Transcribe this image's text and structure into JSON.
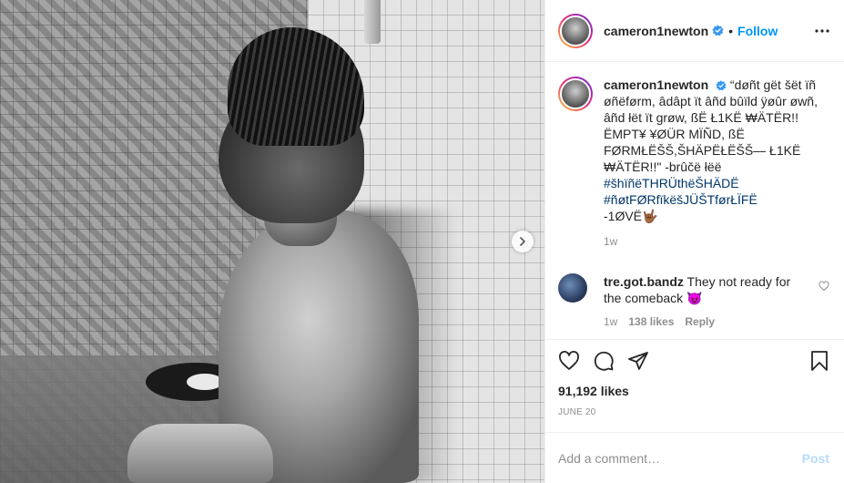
{
  "post": {
    "username": "cameron1newton",
    "follow_label": "Follow",
    "dot": "•",
    "caption": {
      "username": "cameron1newton",
      "text": " “døñt gët šët ïñ øñëførm, âdâpt ït âñd bûïld ÿøûr øwñ, âñd łët ït grøw, ßË Ł1KË ₩ÄTËR!! ËMPT¥ ¥ØÜR MÏÑD, ßË FØRMŁËŠŠ,ŠHÄPËŁËŠŠ— Ł1KË ₩ÄTËR!!\" -brûčë łëë",
      "hashtags": [
        "#šhïñëTHRÜthëŠHÄDË",
        "#ñøtFØRfïkëšJÜŠTførŁÏFË"
      ],
      "signoff": "-1ØVË🤟🏾",
      "age": "1w"
    },
    "comments": [
      {
        "username": "tre.got.bandz",
        "text": " They not ready for the comeback 😈",
        "age": "1w",
        "likes": "138 likes",
        "reply_label": "Reply"
      }
    ],
    "likes": "91,192 likes",
    "date": "JUNE 20",
    "add_comment_placeholder": "Add a comment…",
    "post_label": "Post"
  },
  "icons": {
    "verified": "verified-badge-icon",
    "more": "more-options-icon",
    "like": "heart-icon",
    "comment": "comment-icon",
    "share": "share-icon",
    "save": "bookmark-icon",
    "next": "chevron-right-icon"
  },
  "colors": {
    "accent": "#0095f6",
    "hashtag": "#00376b",
    "muted": "#8e8e8e",
    "post_disabled": "#b3dbff"
  }
}
